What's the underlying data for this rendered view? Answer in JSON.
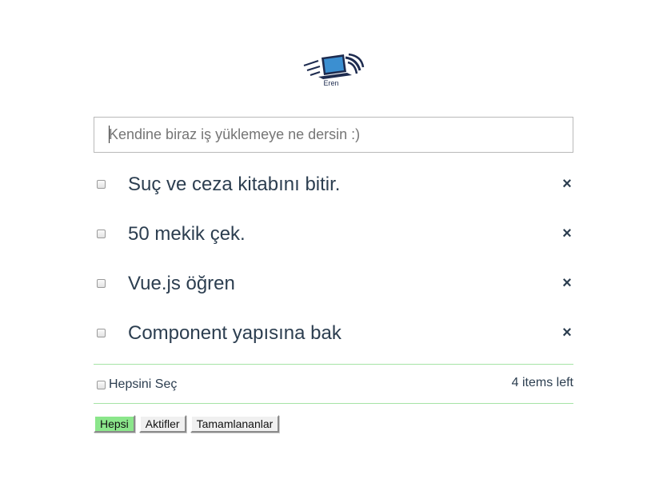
{
  "logo": {
    "text": "Eren",
    "colors": {
      "primary": "#1d2b4f",
      "screen": "#3b8fd1"
    }
  },
  "new_todo": {
    "placeholder": "Kendine biraz iş yüklemeye ne dersin :)",
    "value": ""
  },
  "todos": [
    {
      "label": "Suç ve ceza kitabını bitir.",
      "completed": false,
      "remove_icon": "×"
    },
    {
      "label": "50 mekik çek.",
      "completed": false,
      "remove_icon": "×"
    },
    {
      "label": "Vue.js öğren",
      "completed": false,
      "remove_icon": "×"
    },
    {
      "label": "Component yapısına bak",
      "completed": false,
      "remove_icon": "×"
    }
  ],
  "footer": {
    "select_all_label": "Hepsini Seç",
    "items_left": "4 items left"
  },
  "filters": [
    {
      "label": "Hepsi",
      "active": true
    },
    {
      "label": "Aktifler",
      "active": false
    },
    {
      "label": "Tamamlananlar",
      "active": false
    }
  ],
  "colors": {
    "accent_green": "#8be68b",
    "divider_green": "#a6e3a6",
    "text": "#2c3e50"
  }
}
